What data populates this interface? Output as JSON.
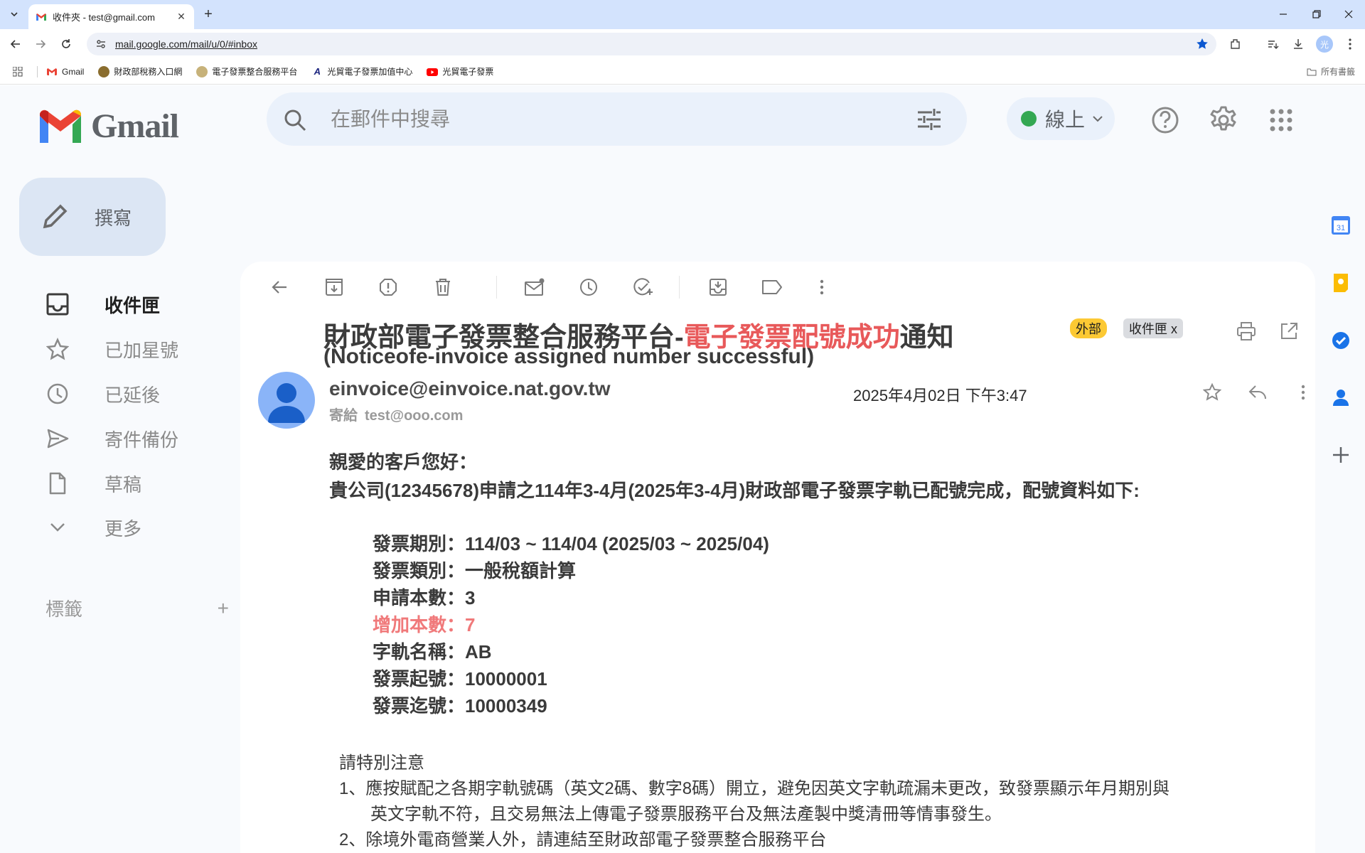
{
  "browser": {
    "tab_title": "收件夾 - test@gmail.com",
    "url": "mail.google.com/mail/u/0/#inbox",
    "profile_initial": "光",
    "bookmarks": [
      "Gmail",
      "財政部稅務入口網",
      "電子發票整合服務平台",
      "光貿電子發票加值中心",
      "光貿電子發票"
    ],
    "all_bookmarks": "所有書籤"
  },
  "gmail": {
    "logo_text": "Gmail",
    "search_placeholder": "在郵件中搜尋",
    "status": "線上",
    "compose_label": "撰寫",
    "nav": {
      "inbox": "收件匣",
      "starred": "已加星號",
      "snoozed": "已延後",
      "sent": "寄件備份",
      "drafts": "草稿",
      "more": "更多"
    },
    "labels_heading": "標籤"
  },
  "email": {
    "subject_prefix": "財政部電子發票整合服務平台-",
    "subject_highlight": "電子發票配號成功",
    "subject_suffix": "通知",
    "subject_en": "(Noticeofe-invoice assigned number successful)",
    "chip_external": "外部",
    "chip_inbox": "收件匣 x",
    "sender": "einvoice@einvoice.nat.gov.tw",
    "to_label": "寄給",
    "to_address": "test@ooo.com",
    "date": "2025年4月02日 下午3:47",
    "greeting": "親愛的客戶您好：",
    "intro": "貴公司(12345678)申請之114年3-4月(2025年3-4月)財政部電子發票字軌已配號完成，配號資料如下:",
    "fields": {
      "period": "發票期別：114/03 ~ 114/04 (2025/03 ~ 2025/04)",
      "type": "發票類別：一般稅額計算",
      "applied": "申請本數：3",
      "added": "增加本數：7",
      "track": "字軌名稱：AB",
      "start": "發票起號：10000001",
      "end": "發票迄號：10000349"
    },
    "notes_title": "請特別注意",
    "note1_line1": "1、應按賦配之各期字軌號碼（英文2碼、數字8碼）開立，避免因英文字軌疏漏未更改，致發票顯示年月期別與",
    "note1_line2": "英文字軌不符，且交易無法上傳電子發票服務平台及無法產製中獎清冊等情事發生。",
    "note2": "2、除境外電商營業人外，請連結至財政部電子發票整合服務平台"
  }
}
